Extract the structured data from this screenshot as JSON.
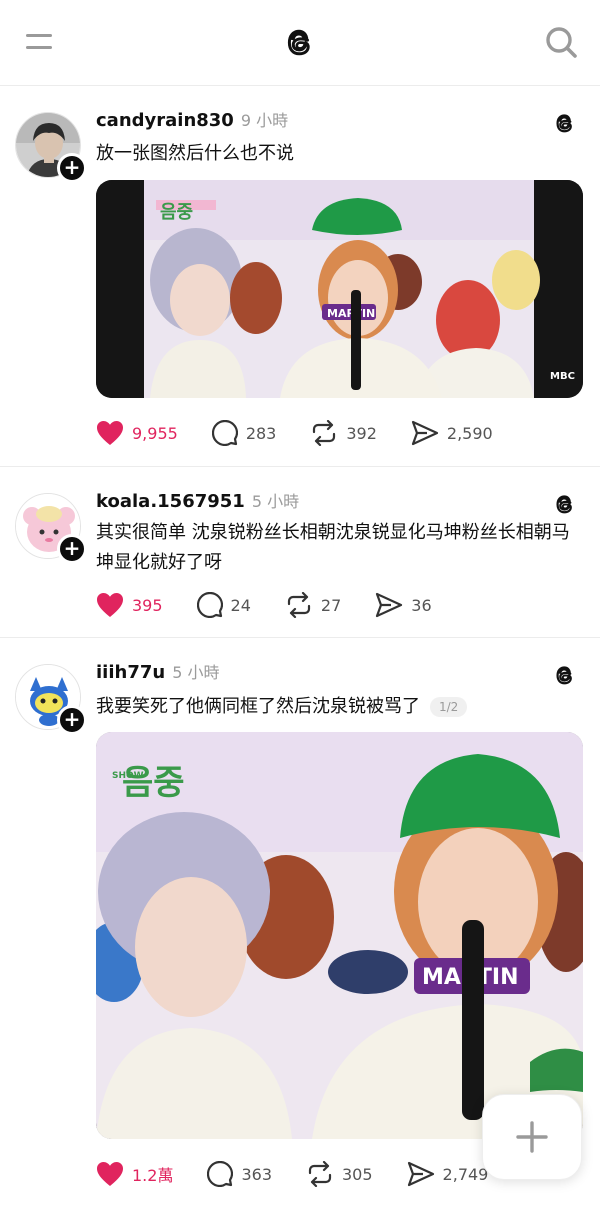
{
  "header": {
    "menu_icon": "hamburger-icon",
    "logo": "threads-logo",
    "search_icon": "search-icon"
  },
  "posts": [
    {
      "username": "candyrain830",
      "time": "9 小時",
      "text": "放一张图然后什么也不说",
      "image": {
        "logo_text": "음중",
        "name_tag": "MARTIN",
        "broadcaster": "MBC"
      },
      "likes": "9,955",
      "comments": "283",
      "reposts": "392",
      "shares": "2,590"
    },
    {
      "username": "koala.1567951",
      "time": "5 小時",
      "text": "其实很简单 沈泉锐粉丝长相朝沈泉锐显化马坤粉丝长相朝马坤显化就好了呀",
      "likes": "395",
      "comments": "24",
      "reposts": "27",
      "shares": "36"
    },
    {
      "username": "iiih77u",
      "time": "5 小時",
      "text": "我要笑死了他俩同框了然后沈泉锐被骂了",
      "pager": "1/2",
      "image": {
        "logo_text": "음중",
        "show_text": "SHOW",
        "name_tag": "MARTIN"
      },
      "likes": "1.2萬",
      "comments": "363",
      "reposts": "305",
      "shares": "2,749"
    }
  ],
  "fab": {
    "icon": "plus-icon"
  },
  "colors": {
    "like_red": "#e0245e",
    "text": "#111111",
    "muted": "#9b9b9b",
    "hat_green": "#1f9a47"
  }
}
